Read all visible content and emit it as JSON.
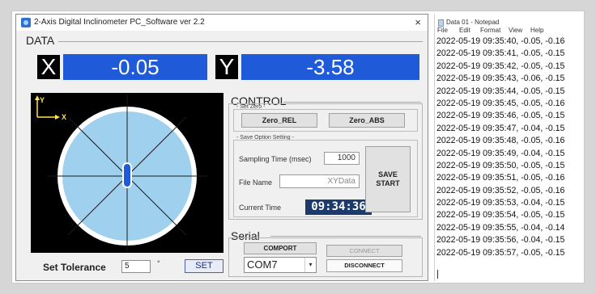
{
  "window": {
    "title": "2-Axis Digital Inclinometer PC_Software ver 2.2",
    "close_glyph": "×"
  },
  "data_section": {
    "label": "DATA",
    "x_letter": "X",
    "x_value": "-0.05",
    "y_letter": "Y",
    "y_value": "-3.58"
  },
  "visual": {
    "axis_y": "Y",
    "axis_x": "X",
    "circle_color": "#9fd1ef",
    "bubble_color": "#1f5bd9"
  },
  "tolerance": {
    "label": "Set Tolerance",
    "value": "5",
    "unit": "°",
    "set_label": "SET"
  },
  "control": {
    "label": "CONTROL",
    "set_zero_caption": "- Set Zero -",
    "zero_rel": "Zero_REL",
    "zero_abs": "Zero_ABS",
    "save_option_caption": "- Save Option Setting -",
    "sampling_label": "Sampling Time (msec)",
    "sampling_value": "1000",
    "file_name_label": "File Name",
    "file_name_value": "XYData",
    "current_time_label": "Current Time",
    "current_time_value": "09:34:36",
    "save_line1": "SAVE",
    "save_line2": "START"
  },
  "serial": {
    "label": "Serial",
    "comport_caption": "COMPORT",
    "comport_value": "COM7",
    "connect_label": "CONNECT",
    "disconnect_label": "DISCONNECT"
  },
  "notepad": {
    "title": "Data 01 - Notepad",
    "menu": [
      "File",
      "Edit",
      "Format",
      "View",
      "Help"
    ],
    "lines": [
      "2022-05-19 09:35:40, -0.05, -0.16",
      "2022-05-19 09:35:41, -0.05, -0.15",
      "2022-05-19 09:35:42, -0.05, -0.15",
      "2022-05-19 09:35:43, -0.06, -0.15",
      "2022-05-19 09:35:44, -0.05, -0.15",
      "2022-05-19 09:35:45, -0.05, -0.16",
      "2022-05-19 09:35:46, -0.05, -0.15",
      "2022-05-19 09:35:47, -0.04, -0.15",
      "2022-05-19 09:35:48, -0.05, -0.16",
      "2022-05-19 09:35:49, -0.04, -0.15",
      "2022-05-19 09:35:50, -0.05, -0.15",
      "2022-05-19 09:35:51, -0.05, -0.16",
      "2022-05-19 09:35:52, -0.05, -0.16",
      "2022-05-19 09:35:53, -0.04, -0.15",
      "2022-05-19 09:35:54, -0.05, -0.15",
      "2022-05-19 09:35:55, -0.04, -0.14",
      "2022-05-19 09:35:56, -0.04, -0.15",
      "2022-05-19 09:35:57, -0.05, -0.15"
    ]
  }
}
